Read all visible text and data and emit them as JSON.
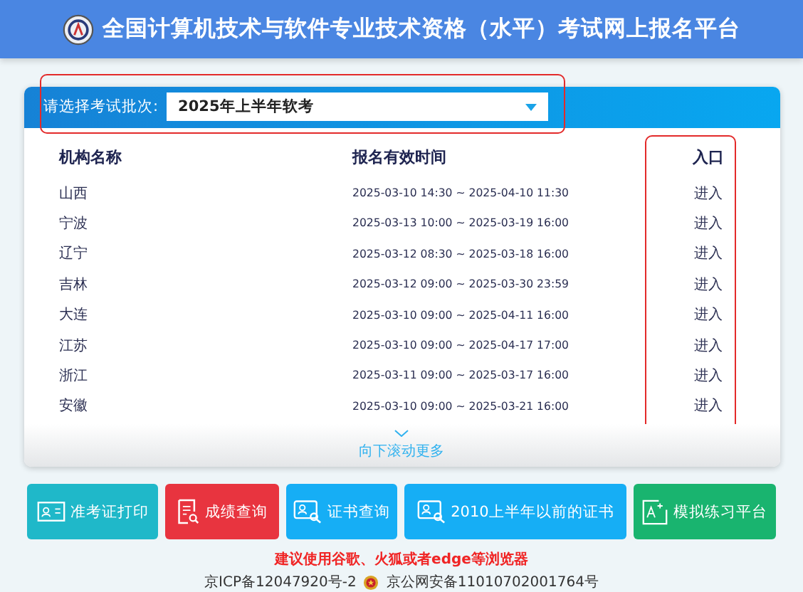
{
  "header": {
    "title": "全国计算机技术与软件专业技术资格（水平）考试网上报名平台"
  },
  "batch_select": {
    "label": "请选择考试批次:",
    "value": "2025年上半年软考"
  },
  "table": {
    "columns": [
      "机构名称",
      "报名有效时间",
      "入口"
    ],
    "rows": [
      {
        "name": "山西",
        "period": "2025-03-10 14:30 ~ 2025-04-10 11:30",
        "entry": "进入"
      },
      {
        "name": "宁波",
        "period": "2025-03-13 10:00 ~ 2025-03-19 16:00",
        "entry": "进入"
      },
      {
        "name": "辽宁",
        "period": "2025-03-12 08:30 ~ 2025-03-18 16:00",
        "entry": "进入"
      },
      {
        "name": "吉林",
        "period": "2025-03-12 09:00 ~ 2025-03-30 23:59",
        "entry": "进入"
      },
      {
        "name": "大连",
        "period": "2025-03-10 09:00 ~ 2025-04-11 16:00",
        "entry": "进入"
      },
      {
        "name": "江苏",
        "period": "2025-03-10 09:00 ~ 2025-04-17 17:00",
        "entry": "进入"
      },
      {
        "name": "浙江",
        "period": "2025-03-11 09:00 ~ 2025-03-17 16:00",
        "entry": "进入"
      },
      {
        "name": "安徽",
        "period": "2025-03-10 09:00 ~ 2025-03-21 16:00",
        "entry": "进入"
      }
    ]
  },
  "scroll_hint": "向下滚动更多",
  "buttons": [
    {
      "label": "准考证打印",
      "color": "#1fb8c9",
      "kind": "card"
    },
    {
      "label": "成绩查询",
      "color": "#e8343f",
      "kind": "doc"
    },
    {
      "label": "证书查询",
      "color": "#16aef5",
      "kind": "cert"
    },
    {
      "label": "2010上半年以前的证书",
      "color": "#16aef5",
      "kind": "cert"
    },
    {
      "label": "模拟练习平台",
      "color": "#19b46f",
      "kind": "practice"
    }
  ],
  "browser_notice": "建议使用谷歌、火狐或者edge等浏览器",
  "footer": {
    "icp": "京ICP备12047920号-2",
    "police": "京公网安备11010702001764号"
  }
}
